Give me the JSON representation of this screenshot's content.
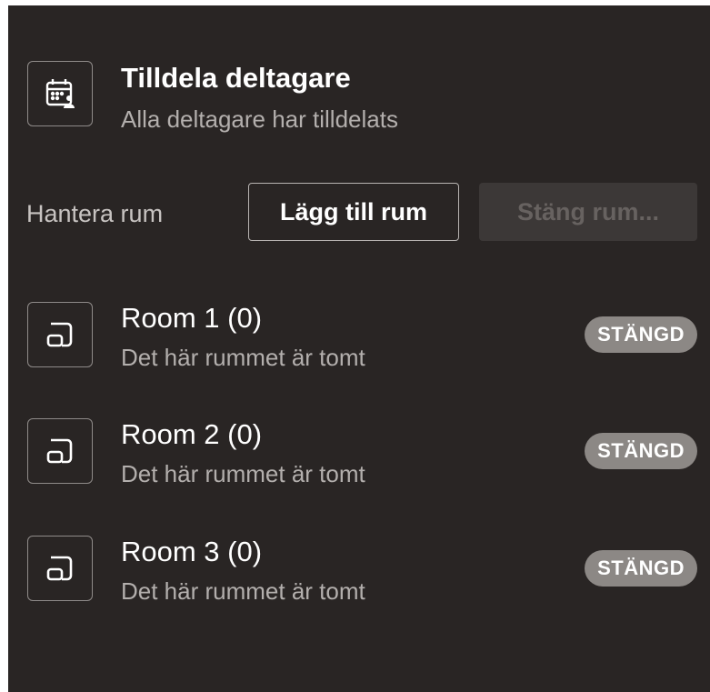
{
  "header": {
    "icon": "calendar-people-icon",
    "title": "Tilldela deltagare",
    "subtitle": "Alla deltagare har tilldelats"
  },
  "manage": {
    "label": "Hantera rum",
    "add_button": "Lägg till rum",
    "close_button": "Stäng rum..."
  },
  "rooms": [
    {
      "name": "Room 1 (0)",
      "status": "Det här rummet är tomt",
      "badge": "STÄNGD",
      "icon": "room-icon"
    },
    {
      "name": "Room 2 (0)",
      "status": "Det här rummet är tomt",
      "badge": "STÄNGD",
      "icon": "room-icon"
    },
    {
      "name": "Room 3 (0)",
      "status": "Det här rummet är tomt",
      "badge": "STÄNGD",
      "icon": "room-icon"
    }
  ],
  "colors": {
    "background": "#292524",
    "badge": "#8c8885",
    "disabled_button": "#3c3837"
  }
}
